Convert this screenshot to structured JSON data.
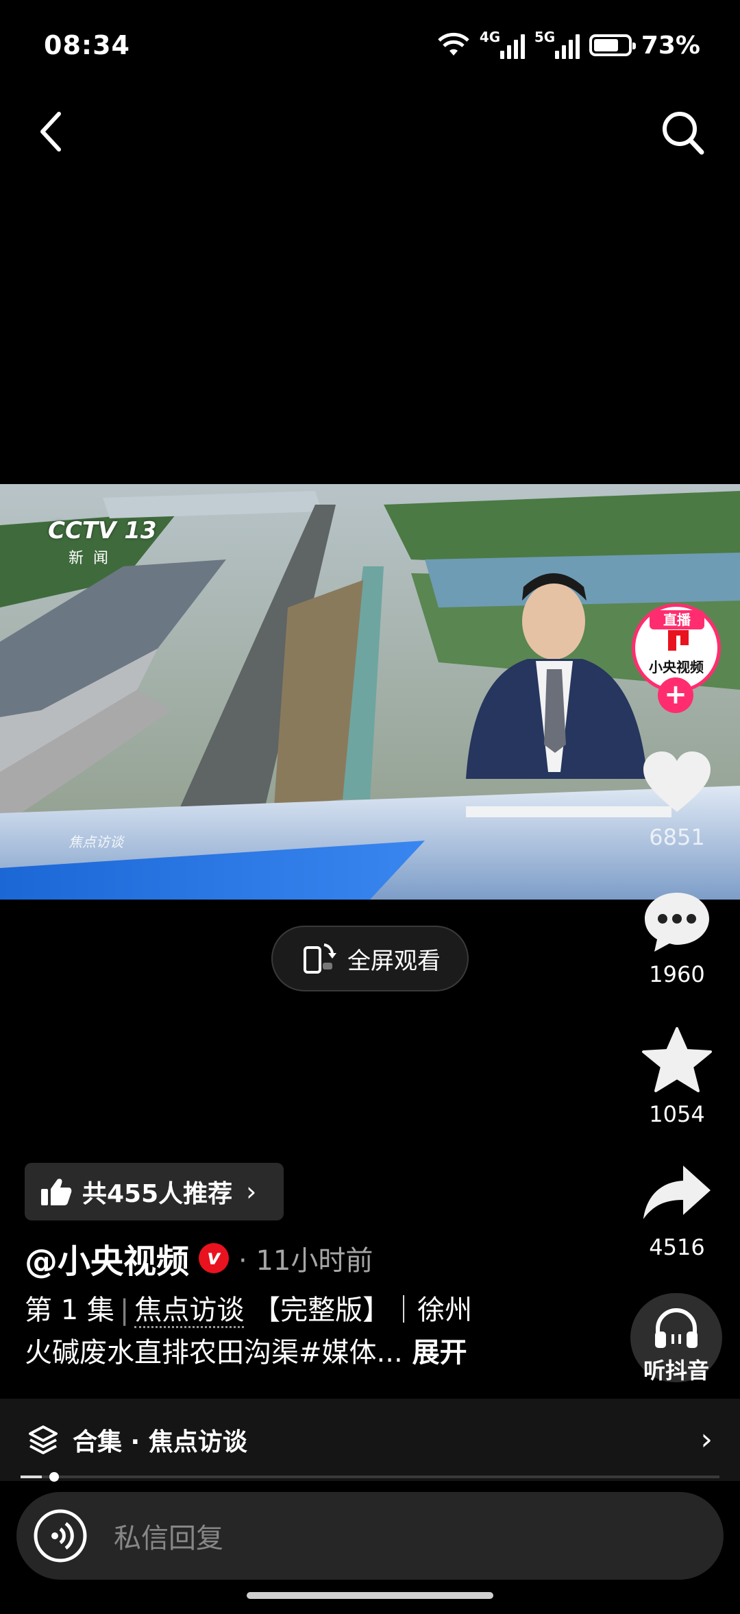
{
  "status_bar": {
    "time": "08:34",
    "network_4g": "4G",
    "network_5g": "5G",
    "battery_percent": "73%",
    "battery_level": 0.73
  },
  "nav": {
    "back_icon": "chevron-left-icon",
    "search_icon": "search-icon"
  },
  "video": {
    "channel_logo": "CCTV 13",
    "channel_sub": "新闻",
    "program_watermark": "焦点访谈"
  },
  "live_badge": {
    "label": "直播",
    "avatar_text": "小央视频",
    "follow": "+"
  },
  "actions": {
    "like_count": "6851",
    "comment_count": "1960",
    "favorite_count": "1054",
    "share_count": "4516",
    "listen_label": "听抖音"
  },
  "fullscreen": {
    "label": "全屏观看"
  },
  "recommend": {
    "label": "共455人推荐",
    "chevron": "›"
  },
  "author": {
    "name": "@小央视频",
    "verified_mark": "v",
    "time": "· 11小时前"
  },
  "caption": {
    "episode": "第 1 集",
    "separator": "|",
    "program": "焦点访谈",
    "rest_line1": "【完整版】｜徐州",
    "line2": "火碱废水直排农田沟渠#媒体...",
    "expand": "展开"
  },
  "collection": {
    "label": "合集 · 焦点访谈",
    "chevron": "›"
  },
  "playback": {
    "progress": 0.03
  },
  "reply": {
    "placeholder": "私信回复"
  },
  "colors": {
    "accent_pink": "#ff2d6f",
    "verified_red": "#e8131f",
    "background": "#000000"
  }
}
